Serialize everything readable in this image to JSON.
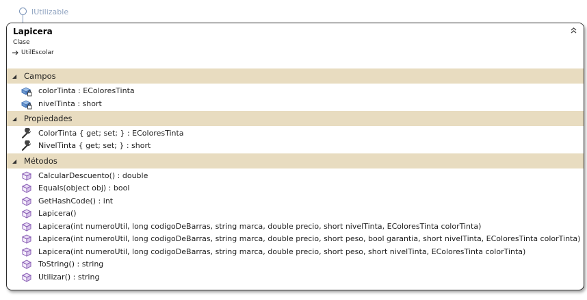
{
  "interface": {
    "name": "IUtilizable"
  },
  "class": {
    "name": "Lapicera",
    "kind": "Clase",
    "base": "UtilEscolar",
    "collapse_glyph": "⌃"
  },
  "sections": {
    "campos": {
      "title": "Campos",
      "items": [
        "colorTinta : EColoresTinta",
        "nivelTinta : short"
      ]
    },
    "propiedades": {
      "title": "Propiedades",
      "items": [
        "ColorTinta { get; set; } : EColoresTinta",
        "NivelTinta { get; set; } : short"
      ]
    },
    "metodos": {
      "title": "Métodos",
      "items": [
        "CalcularDescuento() : double",
        "Equals(object obj) : bool",
        "GetHashCode() : int",
        "Lapicera()",
        "Lapicera(int numeroUtil, long codigoDeBarras, string marca, double precio, short nivelTinta, EColoresTinta colorTinta)",
        "Lapicera(int numeroUtil, long codigoDeBarras, string marca, double precio, short peso, bool garantia, short nivelTinta, EColoresTinta colorTinta)",
        "Lapicera(int numeroUtil, long codigoDeBarras, string marca, double precio, short peso, short nivelTinta, EColoresTinta colorTinta)",
        "ToString() : string",
        "Utilizar() : string"
      ]
    }
  },
  "icons": {
    "field": "private-field-icon",
    "property": "wrench-icon",
    "method": "method-cube-icon"
  },
  "colors": {
    "section_header": "#e8dcc0",
    "cube": "#8a5fb5",
    "field": "#3f6fb4",
    "interface": "#7a93b8"
  }
}
